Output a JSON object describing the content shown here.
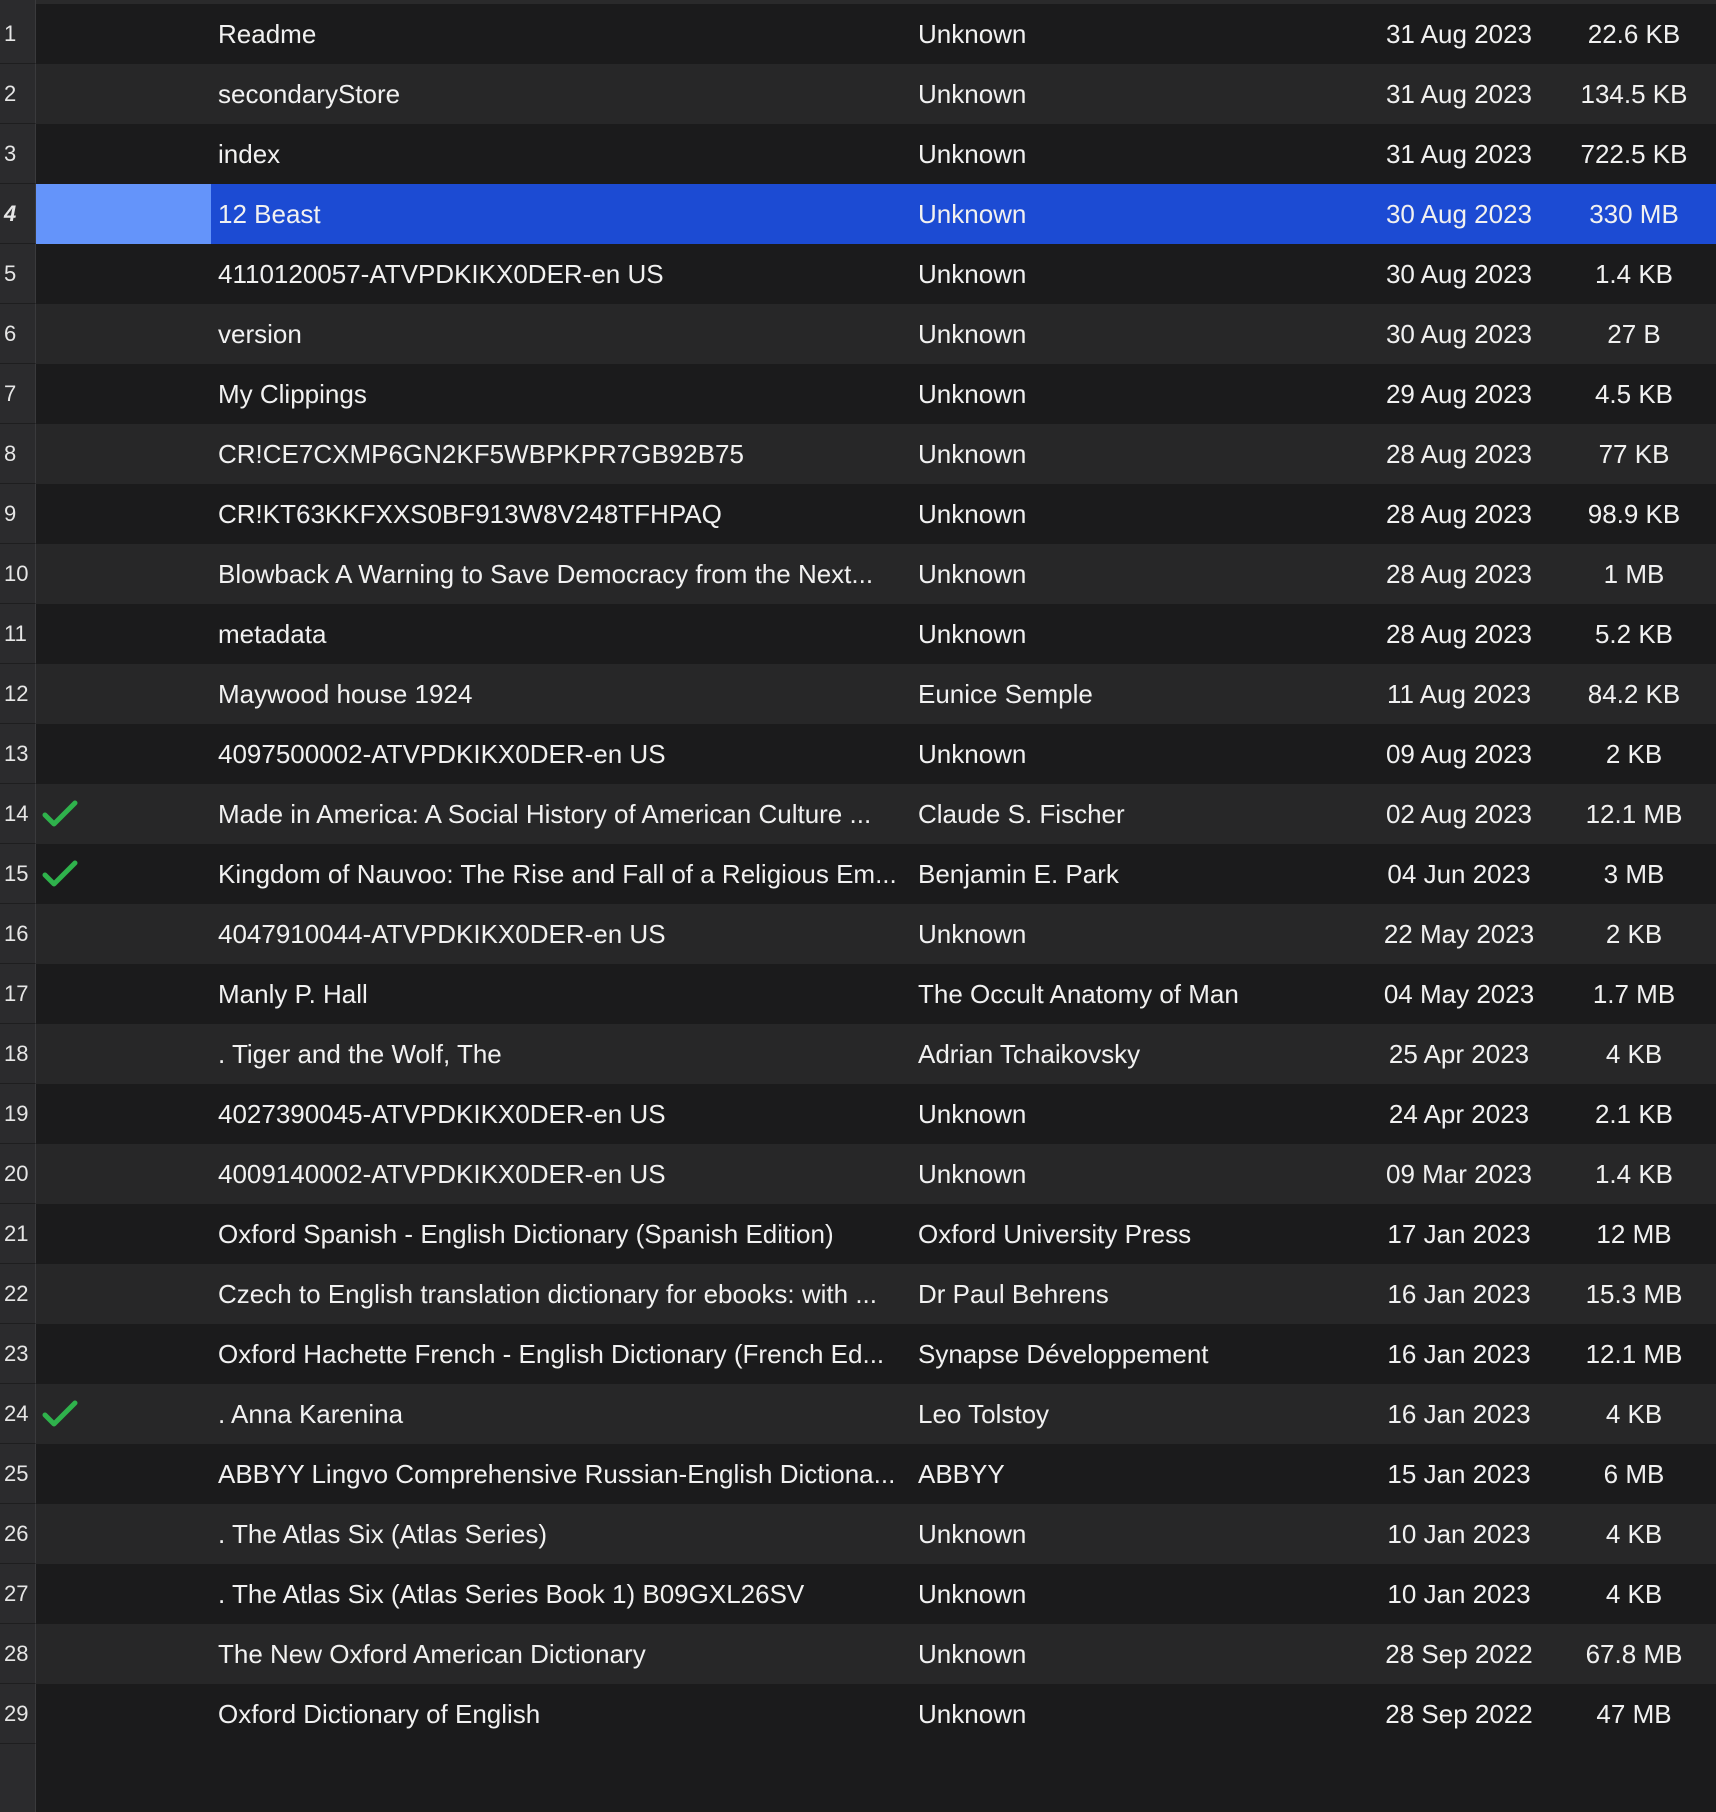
{
  "rows": [
    {
      "num": "1",
      "title": "Readme",
      "author": "Unknown",
      "date": "31 Aug 2023",
      "size": "22.6 KB",
      "checked": false
    },
    {
      "num": "2",
      "title": "secondaryStore",
      "author": "Unknown",
      "date": "31 Aug 2023",
      "size": "134.5 KB",
      "checked": false
    },
    {
      "num": "3",
      "title": "index",
      "author": "Unknown",
      "date": "31 Aug 2023",
      "size": "722.5 KB",
      "checked": false
    },
    {
      "num": "4",
      "title": "12 Beast",
      "author": "Unknown",
      "date": "30 Aug 2023",
      "size": "330 MB",
      "checked": false,
      "selected": true
    },
    {
      "num": "5",
      "title": "4110120057-ATVPDKIKX0DER-en US",
      "author": "Unknown",
      "date": "30 Aug 2023",
      "size": "1.4 KB",
      "checked": false
    },
    {
      "num": "6",
      "title": "version",
      "author": "Unknown",
      "date": "30 Aug 2023",
      "size": "27 B",
      "checked": false
    },
    {
      "num": "7",
      "title": "My Clippings",
      "author": "Unknown",
      "date": "29 Aug 2023",
      "size": "4.5 KB",
      "checked": false
    },
    {
      "num": "8",
      "title": "CR!CE7CXMP6GN2KF5WBPKPR7GB92B75",
      "author": "Unknown",
      "date": "28 Aug 2023",
      "size": "77 KB",
      "checked": false
    },
    {
      "num": "9",
      "title": "CR!KT63KKFXXS0BF913W8V248TFHPAQ",
      "author": "Unknown",
      "date": "28 Aug 2023",
      "size": "98.9 KB",
      "checked": false
    },
    {
      "num": "10",
      "title": "Blowback  A Warning to Save Democracy from the Next...",
      "author": "Unknown",
      "date": "28 Aug 2023",
      "size": "1 MB",
      "checked": false
    },
    {
      "num": "11",
      "title": "metadata",
      "author": "Unknown",
      "date": "28 Aug 2023",
      "size": "5.2 KB",
      "checked": false
    },
    {
      "num": "12",
      "title": "Maywood house 1924",
      "author": "Eunice Semple",
      "date": "11 Aug 2023",
      "size": "84.2 KB",
      "checked": false
    },
    {
      "num": "13",
      "title": "4097500002-ATVPDKIKX0DER-en US",
      "author": "Unknown",
      "date": "09 Aug 2023",
      "size": "2 KB",
      "checked": false
    },
    {
      "num": "14",
      "title": "Made in America: A Social History of American Culture ...",
      "author": "Claude S. Fischer",
      "date": "02 Aug 2023",
      "size": "12.1 MB",
      "checked": true
    },
    {
      "num": "15",
      "title": "Kingdom of Nauvoo: The Rise and Fall of a Religious Em...",
      "author": "Benjamin E. Park",
      "date": "04 Jun 2023",
      "size": "3 MB",
      "checked": true
    },
    {
      "num": "16",
      "title": "4047910044-ATVPDKIKX0DER-en US",
      "author": "Unknown",
      "date": "22 May 2023",
      "size": "2 KB",
      "checked": false
    },
    {
      "num": "17",
      "title": "Manly P. Hall",
      "author": "The Occult Anatomy of Man",
      "date": "04 May 2023",
      "size": "1.7 MB",
      "checked": false
    },
    {
      "num": "18",
      "title": ". Tiger and the Wolf, The",
      "author": "Adrian Tchaikovsky",
      "date": "25 Apr 2023",
      "size": "4 KB",
      "checked": false
    },
    {
      "num": "19",
      "title": "4027390045-ATVPDKIKX0DER-en US",
      "author": "Unknown",
      "date": "24 Apr 2023",
      "size": "2.1 KB",
      "checked": false
    },
    {
      "num": "20",
      "title": "4009140002-ATVPDKIKX0DER-en US",
      "author": "Unknown",
      "date": "09 Mar 2023",
      "size": "1.4 KB",
      "checked": false
    },
    {
      "num": "21",
      "title": "Oxford Spanish - English Dictionary (Spanish Edition)",
      "author": "Oxford University Press",
      "date": "17 Jan 2023",
      "size": "12 MB",
      "checked": false
    },
    {
      "num": "22",
      "title": "Czech to English translation dictionary for ebooks: with ...",
      "author": "Dr Paul Behrens",
      "date": "16 Jan 2023",
      "size": "15.3 MB",
      "checked": false
    },
    {
      "num": "23",
      "title": "Oxford Hachette French - English Dictionary (French Ed...",
      "author": "Synapse Développement",
      "date": "16 Jan 2023",
      "size": "12.1 MB",
      "checked": false
    },
    {
      "num": "24",
      "title": ". Anna Karenina",
      "author": "Leo Tolstoy",
      "date": "16 Jan 2023",
      "size": "4 KB",
      "checked": true
    },
    {
      "num": "25",
      "title": "ABBYY Lingvo Comprehensive Russian-English Dictiona...",
      "author": "ABBYY",
      "date": "15 Jan 2023",
      "size": "6 MB",
      "checked": false
    },
    {
      "num": "26",
      "title": ". The Atlas Six (Atlas Series)",
      "author": "Unknown",
      "date": "10 Jan 2023",
      "size": "4 KB",
      "checked": false
    },
    {
      "num": "27",
      "title": ". The Atlas Six (Atlas Series Book 1) B09GXL26SV",
      "author": "Unknown",
      "date": "10 Jan 2023",
      "size": "4 KB",
      "checked": false
    },
    {
      "num": "28",
      "title": "The New Oxford American Dictionary",
      "author": "Unknown",
      "date": "28 Sep 2022",
      "size": "67.8 MB",
      "checked": false
    },
    {
      "num": "29",
      "title": "Oxford Dictionary of English",
      "author": "Unknown",
      "date": "28 Sep 2022",
      "size": "47 MB",
      "checked": false
    }
  ],
  "icons": {
    "checkmark": "checkmark-icon"
  },
  "colors": {
    "selection": "#1c4bd3",
    "selection_mark": "#6494fa",
    "checkmark": "#2fb24c",
    "row_even": "#272728",
    "row_odd": "#1b1b1c"
  }
}
